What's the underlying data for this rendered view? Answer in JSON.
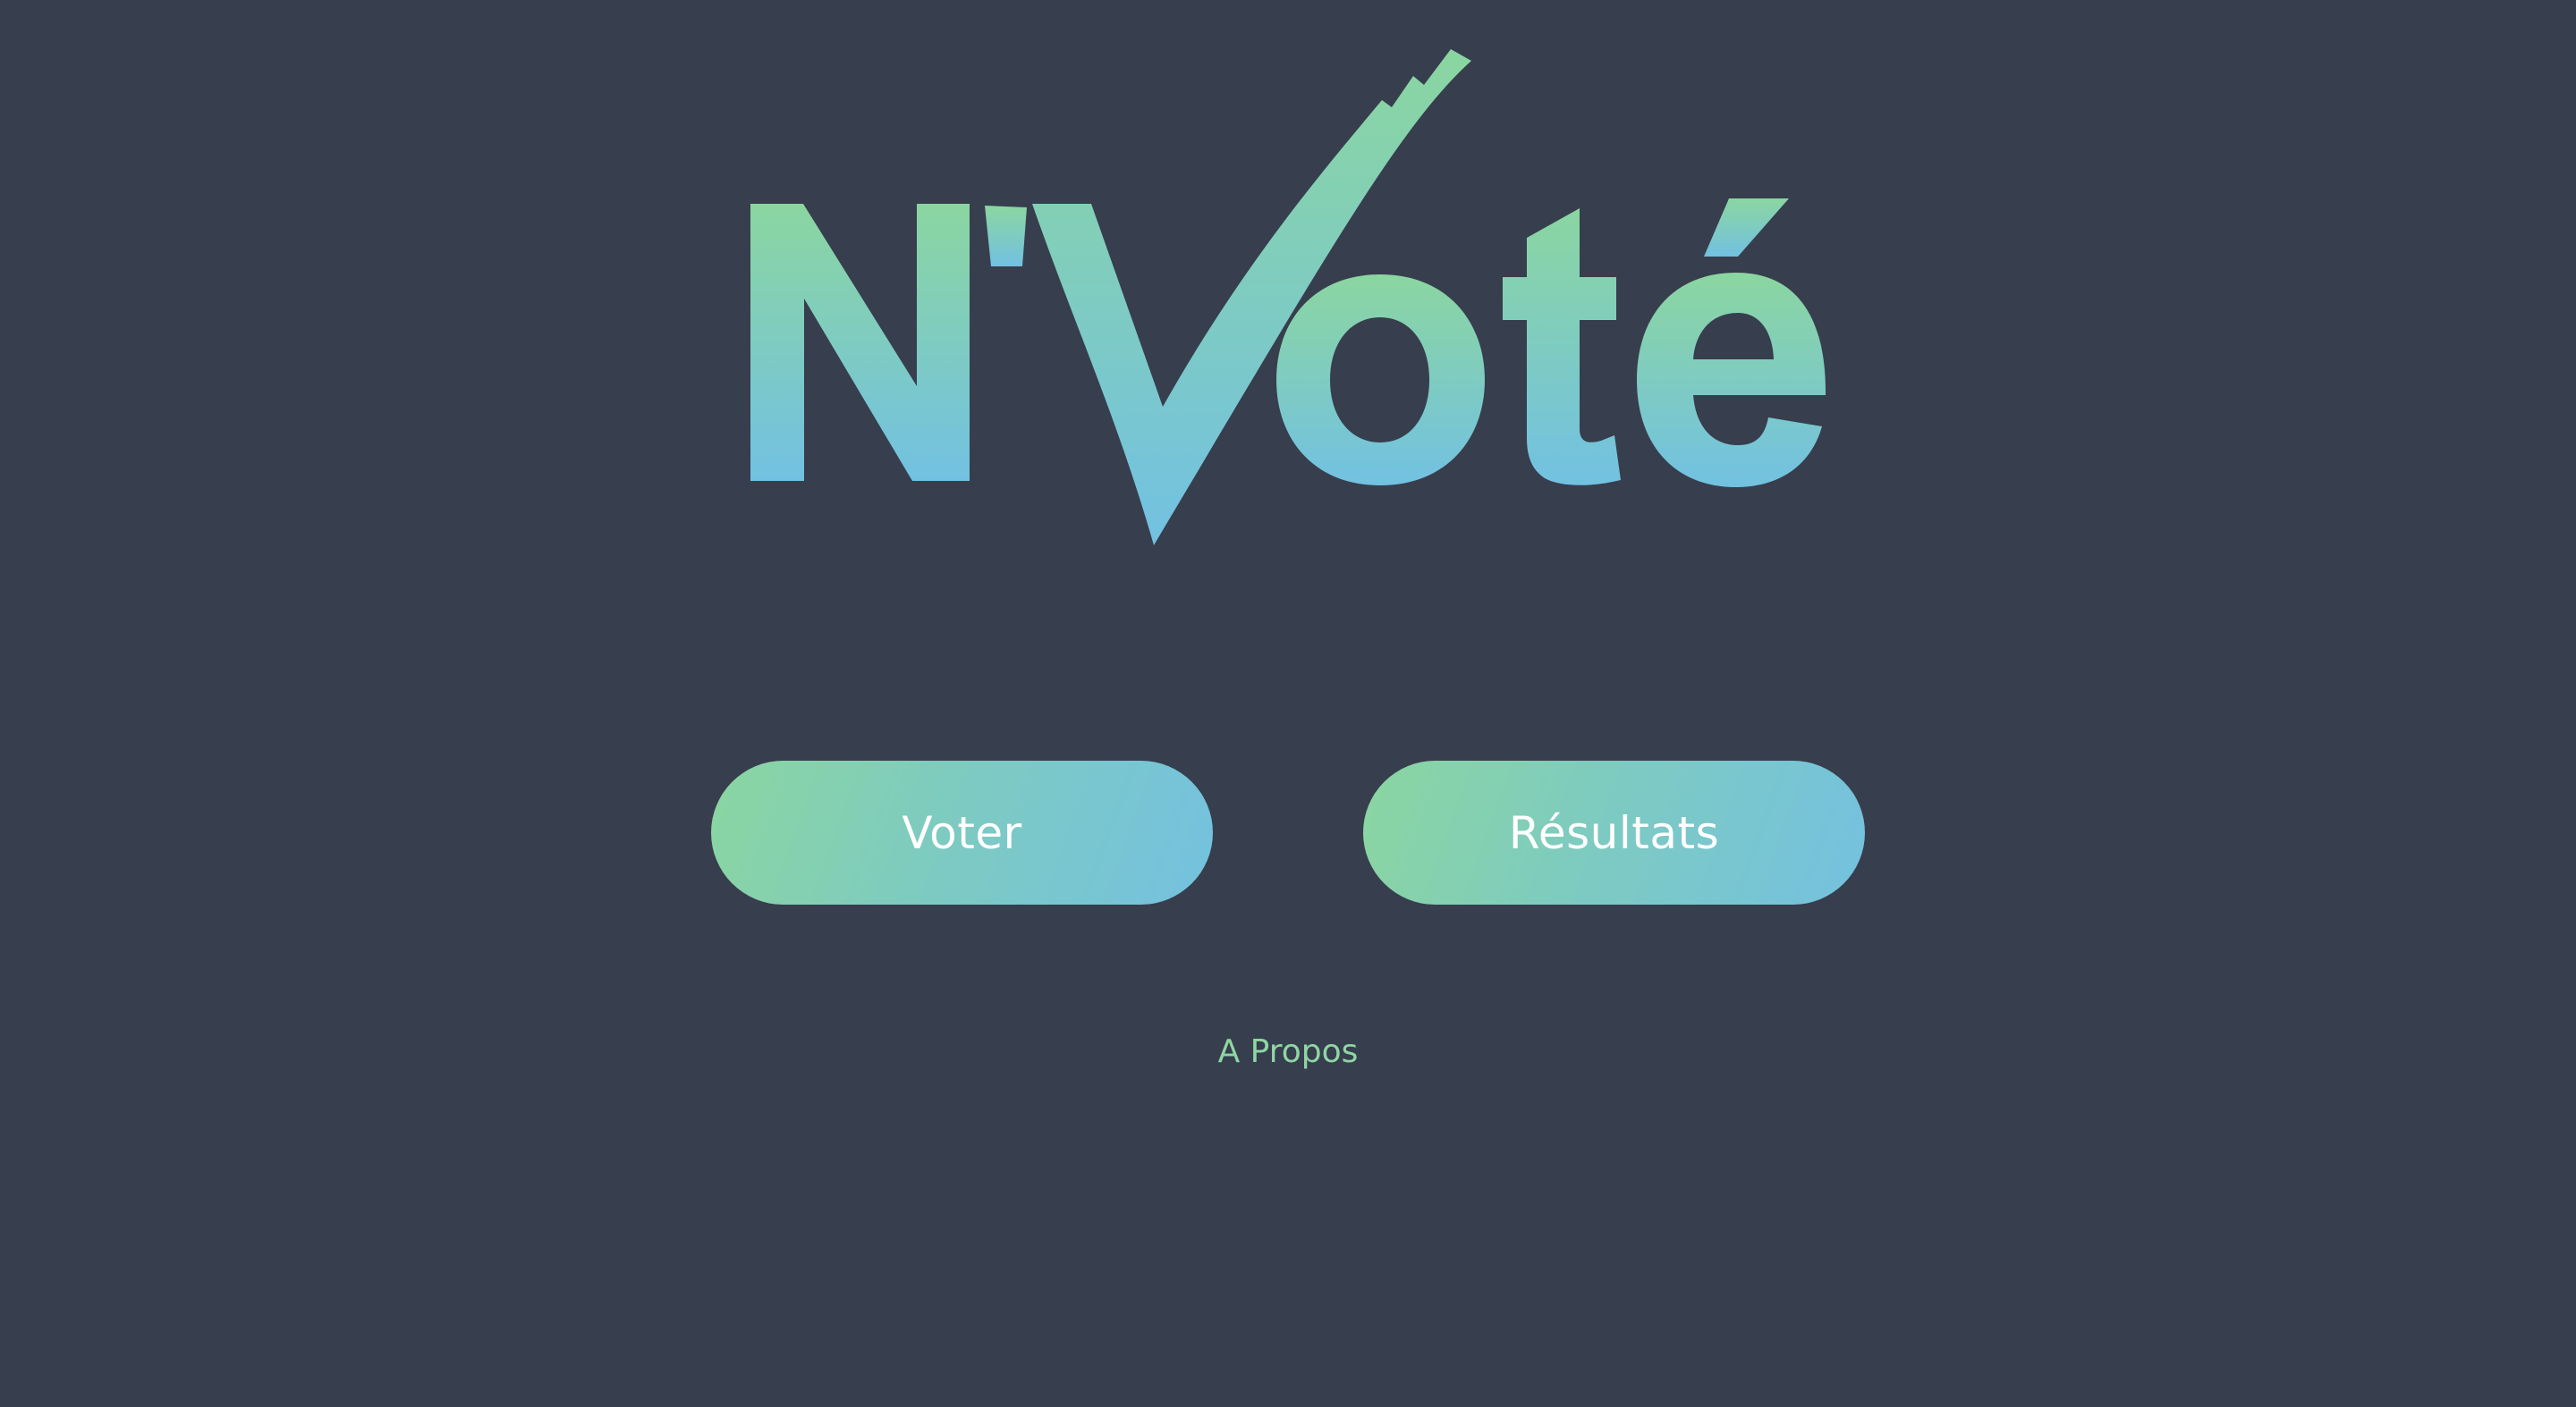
{
  "logo": {
    "text": "N'Voté",
    "colors": {
      "gradient_top": "#8bd6a0",
      "gradient_bottom": "#72c1e2"
    }
  },
  "buttons": {
    "vote_label": "Voter",
    "results_label": "Résultats"
  },
  "footer": {
    "about_label": "A Propos"
  },
  "colors": {
    "background": "#373e4e",
    "accent_green": "#8bd6a0",
    "accent_blue": "#74c1e0",
    "link": "#8fd6a3"
  }
}
